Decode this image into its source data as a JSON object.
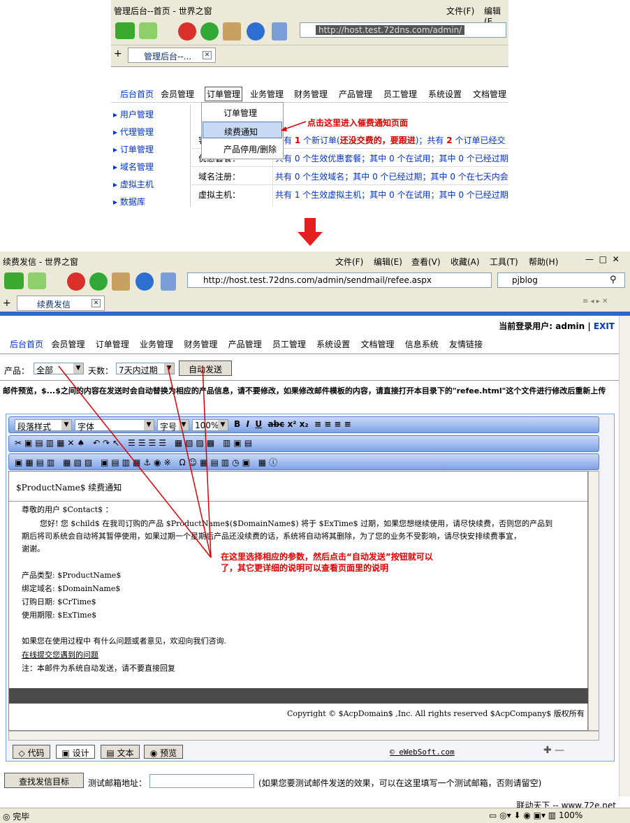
{
  "browser1": {
    "title": "管理后台--首页 - 世界之窗",
    "menu": [
      "文件(F)",
      "编辑(E"
    ],
    "address": "http://host.test.72dns.com/admin/",
    "tab_label": "管理后台--..."
  },
  "nav1": [
    "后台首页",
    "会员管理",
    "订单管理",
    "业务管理",
    "财务管理",
    "产品管理",
    "员工管理",
    "系统设置",
    "文档管理"
  ],
  "left1": [
    "用户管理",
    "代理管理",
    "订单管理",
    "域名管理",
    "虚拟主机",
    "数据库"
  ],
  "dropdown": [
    "订单管理",
    "续费通知",
    "产品停用/删除"
  ],
  "rows1": {
    "r1_label": "客",
    "r1_text_a": "共有",
    "r1_num_a": "1",
    "r1_text_b": "个新订单(",
    "r1_red": "还没交费的，要跟进",
    "r1_text_c": ")；共有",
    "r1_num_b": "2",
    "r1_text_d": "个订单已经交",
    "r2_label": "优惠套餐：",
    "r2_text": "共有 0 个生效优惠套餐；其中 0 个在试用；其中 0 个已经过期",
    "r3_label": "域名注册：",
    "r3_text": "共有 0 个生效域名；其中 0 个已经过期；其中 0 个在七天内会",
    "r4_label": "虚拟主机：",
    "r4_text": "共有 1 个生效虚拟主机；其中 0 个在试用；其中 0 个已经过期"
  },
  "annotation1": "点击这里进入催费通知页面",
  "browser2": {
    "title": "续费发信 - 世界之窗",
    "menu": [
      "文件(F)",
      "编辑(E)",
      "查看(V)",
      "收藏(A)",
      "工具(T)",
      "帮助(H)"
    ],
    "address": "http://host.test.72dns.com/admin/sendmail/refee.aspx",
    "search": "pjblog",
    "tab_label": "续费发信"
  },
  "login": {
    "label": "当前登录用户:",
    "user": "admin",
    "exit": "EXIT"
  },
  "nav2": [
    "后台首页",
    "会员管理",
    "订单管理",
    "业务管理",
    "财务管理",
    "产品管理",
    "员工管理",
    "系统设置",
    "文档管理",
    "信息系统",
    "友情链接"
  ],
  "filter": {
    "product_label": "产品：",
    "product_value": "全部",
    "days_label": "天数：",
    "days_value": "7天内过期",
    "send_button": "自动发送"
  },
  "notice": "邮件预览，$...$之间的内容在发送时会自动替换为相应的产品信息，请不要修改，如果修改邮件模板的内容，请直接打开本目录下的\"refee.html\"这个文件进行修改后重新上传",
  "editor": {
    "selects": [
      "段落样式",
      "字体",
      "字号",
      "100%"
    ],
    "subject": "$ProductName$ 续费通知",
    "greeting": "尊敬的用户 $Contact$ ：",
    "body1": "您好! 您 $child$ 在我司订购的产品 $ProductName$($DomainName$) 将于 $ExTime$ 过期，如果您想继续使用，请尽快续费，否则您的产品到",
    "body2": "期后将司系统会自动将其暂停使用，如果过期一个星期后产品还没续费的话，系统将自动将其删除，为了您的业务不受影响，请尽快安排续费事宜，",
    "body3": "谢谢。",
    "f1": "产品类型: $ProductName$",
    "f2": "绑定域名: $DomainName$",
    "f3": "订购日期: $CrTime$",
    "f4": "使用期限: $ExTime$",
    "q": "如果您在使用过程中 有什么问题或者意见，欢迎向我们咨询.",
    "link": "在线提交您遇到的问题",
    "note": "注：本邮件为系统自动发送，请不要直接回复",
    "copyright": "Copyright © $AcpDomain$ ,Inc. All rights reserved $AcpCompany$ 版权所有",
    "modes": [
      "代码",
      "设计",
      "文本",
      "预览"
    ],
    "brand": "© eWebSoft.com"
  },
  "annotation2_line1": "在这里选择相应的参数，然后点击“自动发送”按钮就可以",
  "annotation2_line2": "了，其它更详细的说明可以查看页面里的说明",
  "footer": {
    "find_button": "查找发信目标",
    "test_label": "测试邮箱地址：",
    "test_hint": "(如果您要测试邮件发送的效果，可以在这里填写一个测试邮箱，否则请留空)",
    "credit": "联动天下 -- www.72e.net",
    "status": "完毕",
    "zoom": "100%"
  }
}
